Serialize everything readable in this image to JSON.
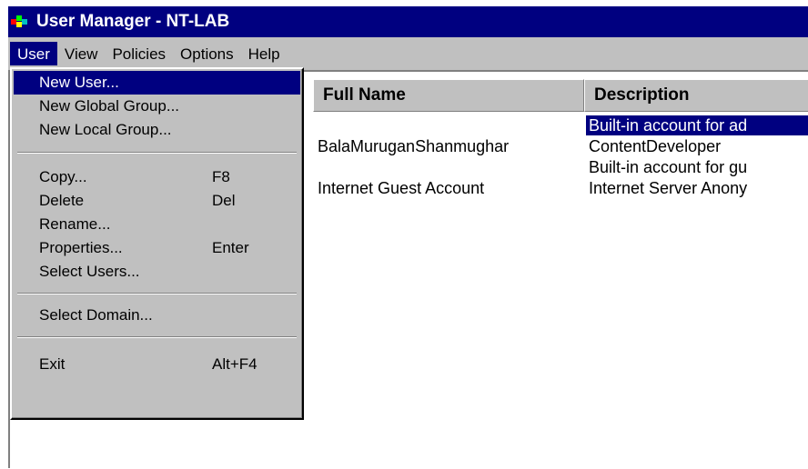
{
  "window": {
    "title": "User Manager - NT-LAB",
    "app_icon": "user-manager-icon"
  },
  "menubar": {
    "items": [
      {
        "label": "User"
      },
      {
        "label": "View"
      },
      {
        "label": "Policies"
      },
      {
        "label": "Options"
      },
      {
        "label": "Help"
      }
    ],
    "active": "User"
  },
  "user_menu": {
    "items": [
      {
        "label": "New User...",
        "shortcut": ""
      },
      {
        "label": "New Global Group...",
        "shortcut": ""
      },
      {
        "label": "New Local Group...",
        "shortcut": ""
      },
      {
        "label": "Copy...",
        "shortcut": "F8"
      },
      {
        "label": "Delete",
        "shortcut": "Del"
      },
      {
        "label": "Rename...",
        "shortcut": ""
      },
      {
        "label": "Properties...",
        "shortcut": "Enter"
      },
      {
        "label": "Select Users...",
        "shortcut": ""
      },
      {
        "label": "Select Domain...",
        "shortcut": ""
      },
      {
        "label": "Exit",
        "shortcut": "Alt+F4"
      }
    ],
    "highlighted": "New User..."
  },
  "listview": {
    "columns": [
      {
        "label": "Full Name"
      },
      {
        "label": "Description"
      }
    ],
    "rows": [
      {
        "full_name": "",
        "description": "Built-in account for ad",
        "selected": true
      },
      {
        "full_name": "BalaMuruganShanmughar",
        "description": "ContentDeveloper",
        "selected": false
      },
      {
        "full_name": "",
        "description": "Built-in account for gu",
        "selected": false
      },
      {
        "full_name": "Internet Guest Account",
        "description": "Internet Server Anony",
        "selected": false
      }
    ]
  },
  "colors": {
    "titlebar": "#000080",
    "highlight": "#000080",
    "chrome": "#c0c0c0"
  }
}
